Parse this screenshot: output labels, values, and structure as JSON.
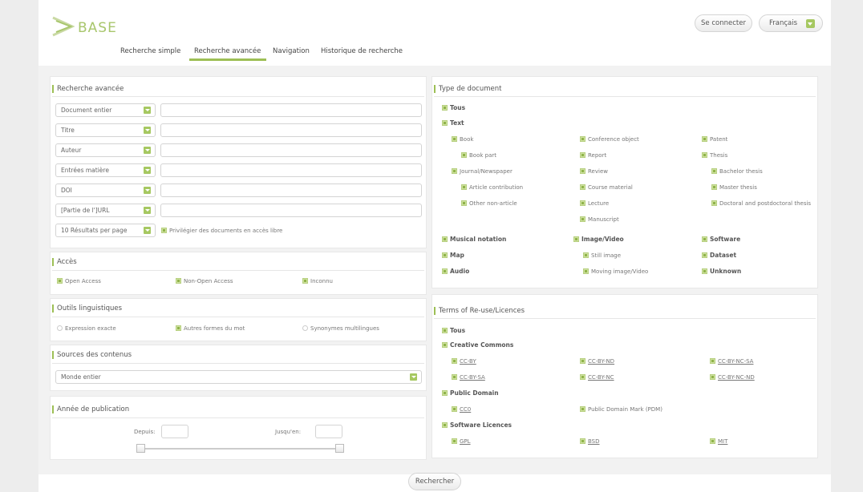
{
  "brand": {
    "logo_text": "BASE"
  },
  "header": {
    "login_label": "Se connecter",
    "language_label": "Français"
  },
  "nav": {
    "tabs": [
      "Recherche simple",
      "Recherche avancée",
      "Navigation",
      "Historique de recherche"
    ],
    "active_tab": "Recherche avancée"
  },
  "advanced": {
    "title": "Recherche avancée",
    "fields": [
      "Document entier",
      "Titre",
      "Auteur",
      "Entrées matière",
      "DOI",
      "[Partie de l']URL"
    ],
    "results_per_page": "10 Résultats per page",
    "open_access_pref": "Privilégier des documents en accès libre"
  },
  "access": {
    "title": "Accès",
    "options": [
      "Open Access",
      "Non-Open Access",
      "Inconnu"
    ]
  },
  "linguistic": {
    "title": "Outils linguistiques",
    "options": [
      "Expression exacte",
      "Autres formes du mot",
      "Synonymes multilingues"
    ]
  },
  "sources": {
    "title": "Sources des contenus",
    "selected": "Monde entier"
  },
  "year": {
    "title": "Année de publication",
    "from_label": "Depuis:",
    "to_label": "Jusqu'en:"
  },
  "doctype": {
    "title": "Type de document",
    "all": "Tous",
    "text": "Text",
    "col1": [
      "Book",
      "Book part",
      "Journal/Newspaper",
      "Article contribution",
      "Other non-article"
    ],
    "col2": [
      "Conference object",
      "Report",
      "Review",
      "Course material",
      "Lecture",
      "Manuscript"
    ],
    "col3": [
      "Patent",
      "Thesis",
      "Bachelor thesis",
      "Master thesis",
      "Doctoral and postdoctoral thesis"
    ],
    "musical": "Musical notation",
    "image_video": "Image/Video",
    "software": "Software",
    "map": "Map",
    "still_image": "Still image",
    "dataset": "Dataset",
    "audio": "Audio",
    "moving_image": "Moving image/Video",
    "unknown": "Unknown"
  },
  "licences": {
    "title": "Terms of Re-use/Licences",
    "all": "Tous",
    "cc_title": "Creative Commons",
    "cc": [
      "CC-BY",
      "CC-BY-ND",
      "CC-BY-NC-SA",
      "CC-BY-SA",
      "CC-BY-NC",
      "CC-BY-NC-ND"
    ],
    "pd_title": "Public Domain",
    "cc0": "CC0",
    "pdm": "Public Domain Mark (PDM)",
    "sw_title": "Software Licences",
    "gpl": "GPL",
    "bsd": "BSD",
    "mit": "MIT"
  },
  "actions": {
    "search_label": "Rechercher"
  },
  "colors": {
    "accent": "#9dbf55",
    "logo": "#a8c66c"
  }
}
